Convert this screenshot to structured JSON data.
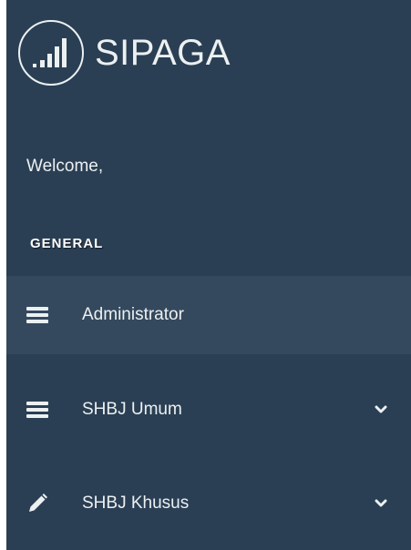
{
  "brand": {
    "name": "SIPAGA"
  },
  "sidebar": {
    "welcome_text": "Welcome,",
    "section_title": "GENERAL",
    "items": [
      {
        "label": "Administrator",
        "icon": "bars-icon",
        "active": true,
        "has_submenu": false
      },
      {
        "label": "SHBJ Umum",
        "icon": "bars-icon",
        "active": false,
        "has_submenu": true
      },
      {
        "label": "SHBJ Khusus",
        "icon": "pencil-icon",
        "active": false,
        "has_submenu": true
      }
    ]
  },
  "colors": {
    "sidebar_bg": "#2a3f54",
    "active_bg": "#34495e",
    "text": "#ECF0F1"
  }
}
